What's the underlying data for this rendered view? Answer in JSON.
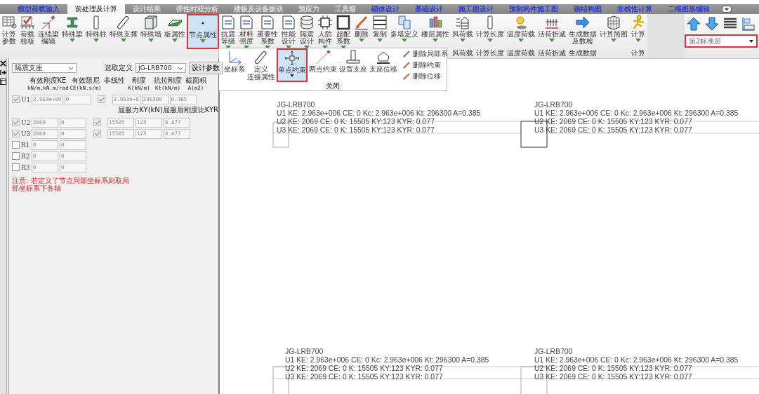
{
  "tabs": [
    {
      "label": "模型荷载输入",
      "selected": false,
      "kind": "module"
    },
    {
      "label": "前处理及计算",
      "selected": true,
      "kind": "plain"
    },
    {
      "label": "设计结果",
      "selected": false,
      "kind": "plain"
    },
    {
      "label": "弹性时程分析",
      "selected": false,
      "kind": "plain"
    },
    {
      "label": "楼板及设备振动",
      "selected": false,
      "kind": "plain"
    },
    {
      "label": "预应力",
      "selected": false,
      "kind": "plain"
    },
    {
      "label": "工具箱",
      "selected": false,
      "kind": "plain"
    },
    {
      "label": "砌体设计",
      "selected": false,
      "kind": "module"
    },
    {
      "label": "基础设计",
      "selected": false,
      "kind": "module"
    },
    {
      "label": "施工图设计",
      "selected": false,
      "kind": "module"
    },
    {
      "label": "预制构件施工图",
      "selected": false,
      "kind": "module"
    },
    {
      "label": "钢结构图",
      "selected": false,
      "kind": "module"
    },
    {
      "label": "非线性计算",
      "selected": false,
      "kind": "module"
    },
    {
      "label": "二维图形编辑",
      "selected": false,
      "kind": "module"
    }
  ],
  "ribbon": {
    "buttons": [
      {
        "lines": [
          "计算",
          "参数"
        ],
        "menu": false,
        "selected": false
      },
      {
        "lines": [
          "荷载",
          "校核"
        ],
        "menu": false,
        "selected": false
      },
      {
        "lines": [
          "连续梁",
          "编辑"
        ],
        "menu": false,
        "selected": false
      },
      {
        "lines": [
          "特殊梁"
        ],
        "menu": true,
        "selected": false
      },
      {
        "lines": [
          "特殊柱"
        ],
        "menu": true,
        "selected": false
      },
      {
        "lines": [
          "特殊支撑"
        ],
        "menu": true,
        "selected": false
      },
      {
        "lines": [
          "特殊墙"
        ],
        "menu": true,
        "selected": false
      },
      {
        "lines": [
          "板属性"
        ],
        "menu": true,
        "selected": false
      },
      {
        "lines": [
          "节点属性"
        ],
        "menu": true,
        "selected": true
      },
      {
        "lines": [
          "抗震",
          "等级"
        ],
        "menu": true,
        "selected": false
      },
      {
        "lines": [
          "材料",
          "强度"
        ],
        "menu": true,
        "selected": false
      },
      {
        "lines": [
          "重要性",
          "系数"
        ],
        "menu": true,
        "selected": false
      },
      {
        "lines": [
          "性能",
          "设计"
        ],
        "menu": true,
        "selected": false
      },
      {
        "lines": [
          "隔震",
          "设计"
        ],
        "menu": true,
        "selected": false
      },
      {
        "lines": [
          "人防",
          "构件"
        ],
        "menu": true,
        "selected": false
      },
      {
        "lines": [
          "超配",
          "系数"
        ],
        "menu": true,
        "selected": false
      },
      {
        "lines": [
          "删除"
        ],
        "menu": true,
        "selected": false
      },
      {
        "lines": [
          "复制"
        ],
        "menu": true,
        "selected": false
      },
      {
        "lines": [
          "多塔定义"
        ],
        "menu": true,
        "selected": false
      },
      {
        "lines": [
          "楼层属性"
        ],
        "menu": true,
        "selected": false
      },
      {
        "lines": [
          "风荷载"
        ],
        "menu": true,
        "selected": false,
        "group": "风荷载"
      },
      {
        "lines": [
          "计算长度"
        ],
        "menu": true,
        "selected": false,
        "group": "计算长度"
      },
      {
        "lines": [
          "温度荷载"
        ],
        "menu": true,
        "selected": false,
        "group": "温度荷载"
      },
      {
        "lines": [
          "活荷折减"
        ],
        "menu": true,
        "selected": false,
        "group": "活荷折减"
      },
      {
        "lines": [
          "生成数据",
          "及数检"
        ],
        "menu": false,
        "selected": false,
        "group": "生成数据"
      },
      {
        "lines": [
          "计算简图"
        ],
        "menu": true,
        "selected": false
      },
      {
        "lines": [
          "计算"
        ],
        "menu": true,
        "selected": false,
        "group": "计算"
      }
    ],
    "floor_select": {
      "value": "第2标准层"
    }
  },
  "node_menu": {
    "items": [
      {
        "lines": [
          "坐标系"
        ],
        "kind": "large",
        "selected": false,
        "menu": false
      },
      {
        "lines": [
          "定义",
          "连接属性"
        ],
        "kind": "large",
        "selected": false,
        "menu": false
      },
      {
        "lines": [
          "单点约束"
        ],
        "kind": "large",
        "selected": true,
        "menu": true
      },
      {
        "lines": [
          "两点约束"
        ],
        "kind": "large",
        "selected": false,
        "menu": false
      },
      {
        "lines": [
          "设置支座"
        ],
        "kind": "large",
        "selected": false,
        "menu": false
      },
      {
        "lines": [
          "支座位移"
        ],
        "kind": "large",
        "selected": false,
        "menu": false
      },
      {
        "lines": [
          "删除局部系"
        ],
        "kind": "small",
        "selected": false
      },
      {
        "lines": [
          "删除约束"
        ],
        "kind": "small",
        "selected": false
      },
      {
        "lines": [
          "删除位移"
        ],
        "kind": "small",
        "selected": false
      }
    ],
    "footer": "关闭"
  },
  "panel": {
    "type_select": "隔震支座",
    "define_label": "选取定义",
    "define_select": "JG-LRB700",
    "params_button": "设计参数",
    "columns": [
      {
        "lines": [
          "有效刚度KE",
          "kN/m,kN.m/rad"
        ]
      },
      {
        "lines": [
          "有效阻尼",
          "CE(kN.s/m)"
        ]
      },
      {
        "lines": [
          "非线性"
        ]
      },
      {
        "lines": [
          "刚度",
          "K(kN/m)"
        ]
      },
      {
        "lines": [
          "抗拉刚度",
          "Kt(kN/m)"
        ]
      },
      {
        "lines": [
          "截面积",
          "A(m2)"
        ]
      }
    ],
    "sub_header": "屈服力KY(kN)屈服后刚度比KYR",
    "rows": [
      {
        "label": "U1",
        "checked": true,
        "disabled": true,
        "ke": "2.963e+00",
        "ce": "0",
        "nonlinear": true,
        "k": "2.963e+0",
        "kt": "296300",
        "a": "0.385"
      },
      {
        "label": "U2",
        "checked": true,
        "disabled": true,
        "ke": "2069",
        "ce": "0",
        "nonlinear": true,
        "k": "15505",
        "kt": "123",
        "a": "0.077"
      },
      {
        "label": "U3",
        "checked": true,
        "disabled": true,
        "ke": "2069",
        "ce": "0",
        "nonlinear": true,
        "k": "15505",
        "kt": "123",
        "a": "0.077"
      },
      {
        "label": "R1",
        "checked": false,
        "disabled": false,
        "ke": "0",
        "ce": "0"
      },
      {
        "label": "R2",
        "checked": false,
        "disabled": false,
        "ke": "0",
        "ce": "0"
      },
      {
        "label": "R3",
        "checked": false,
        "disabled": false,
        "ke": "0",
        "ce": "0"
      }
    ],
    "note": "注意: 若定义了节点局部坐标系则取局部坐标系下各轴"
  },
  "canvas": {
    "labels": [
      {
        "lines": [
          "JG-LRB700",
          "U1 KE: 2.963e+006 CE: 0 Kc: 2.963e+006 Kt: 296300 A=0.385",
          "U2 KE: 2069 CE: 0 K: 15505 KY:123 KYR: 0.077",
          "U3 KE: 2069 CE: 0 K: 15505 KY:123 KYR: 0.077"
        ]
      },
      {
        "lines": [
          "JG-LRB700",
          "U1 KE: 2.963e+006 CE: 0 Kc: 2.963e+006 Kt: 296300 A=0.385",
          "U2 KE: 2069 CE: 0 K: 15505 KY:123 KYR: 0.077",
          "U3 KE: 2069 CE: 0 K: 15505 KY:123 KYR: 0.077"
        ]
      },
      {
        "lines": [
          "JG-LRB700",
          "U1 KE: 2.963e+006 CE: 0 Kc: 2.963e+006 Kt: 296300 A=0.385",
          "U2 KE: 2069 CE: 0 K: 15505 KY:123 KYR: 0.077",
          "U3 KE: 2069 CE: 0 K: 15505 KY:123 KYR: 0.077"
        ]
      },
      {
        "lines": [
          "JG-LRB700",
          "U1 KE: 2.963e+006 CE: 0 Kc: 2.963e+006 Kt: 296300 A=0.385",
          "U2 KE: 2069 CE: 0 K: 15505 KY:123 KYR: 0.077",
          "U3 KE: 2069 CE: 0 K: 15505 KY:123 KYR: 0.077"
        ]
      }
    ]
  }
}
